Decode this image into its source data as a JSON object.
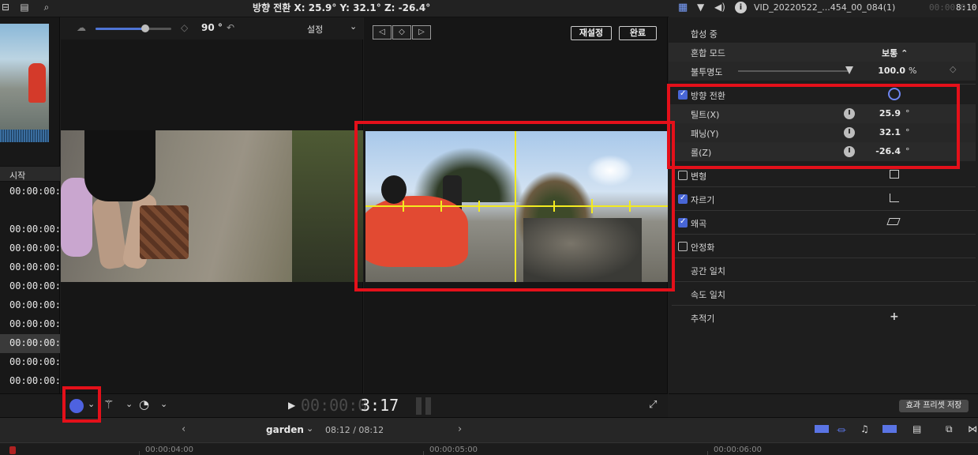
{
  "topbar": {
    "viewer_title": "방향 전환   X: 25.9°   Y: 32.1°   Z: -26.4°",
    "clip_name": "VID_20220522_...454_00_084(1)",
    "clip_duration_gray": "00:00:0",
    "clip_duration": "8:10"
  },
  "viewer_toolbar": {
    "angle_value": "90 °",
    "settings_label": "설정",
    "reset_label": "재설정",
    "done_label": "완료",
    "nav_prev": "◁",
    "nav_keyframe": "◇",
    "nav_next": "▷"
  },
  "event_list": {
    "header": "시작",
    "rows": [
      "00:00:00:0",
      "",
      "00:00:00:0",
      "00:00:00:0",
      "00:00:00:0",
      "00:00:00:0",
      "00:00:00:0",
      "00:00:00:0",
      "00:00:00:0",
      "00:00:00:0",
      "00:00:00:0"
    ]
  },
  "playback": {
    "timecode_dim": "00:00:0",
    "timecode_bright": "3:17"
  },
  "inspector": {
    "compositing_header": "합성 중",
    "blend_mode_label": "혼합 모드",
    "blend_mode_value": "보통 ⌃",
    "opacity_label": "불투명도",
    "opacity_value": "100.0",
    "opacity_unit": "%",
    "opacity_fraction": 1.0,
    "reorient_label": "방향 전환",
    "tilt_label": "틸트(X)",
    "tilt_value": "25.9",
    "pan_label": "패닝(Y)",
    "pan_value": "32.1",
    "roll_label": "롤(Z)",
    "roll_value": "-26.4",
    "degree_unit": "°",
    "transform_label": "변형",
    "crop_label": "자르기",
    "distort_label": "왜곡",
    "stabilize_label": "안정화",
    "spatial_conform_label": "공간 일치",
    "rate_conform_label": "속도 일치",
    "tracker_label": "추적기",
    "tracker_add": "+",
    "save_preset_label": "효과 프리셋 저장",
    "checks": {
      "reorient": true,
      "transform": false,
      "crop": true,
      "distort": true,
      "stabilize": false
    }
  },
  "timeline": {
    "project_name": "garden",
    "duration": "08:12 / 08:12",
    "ruler_labels": [
      "00:00:04:00",
      "00:00:05:00",
      "00:00:06:00"
    ]
  },
  "colors": {
    "accent_blue": "#4866d6",
    "highlight_red": "#e4101a",
    "guide_yellow": "#f2ea20"
  }
}
